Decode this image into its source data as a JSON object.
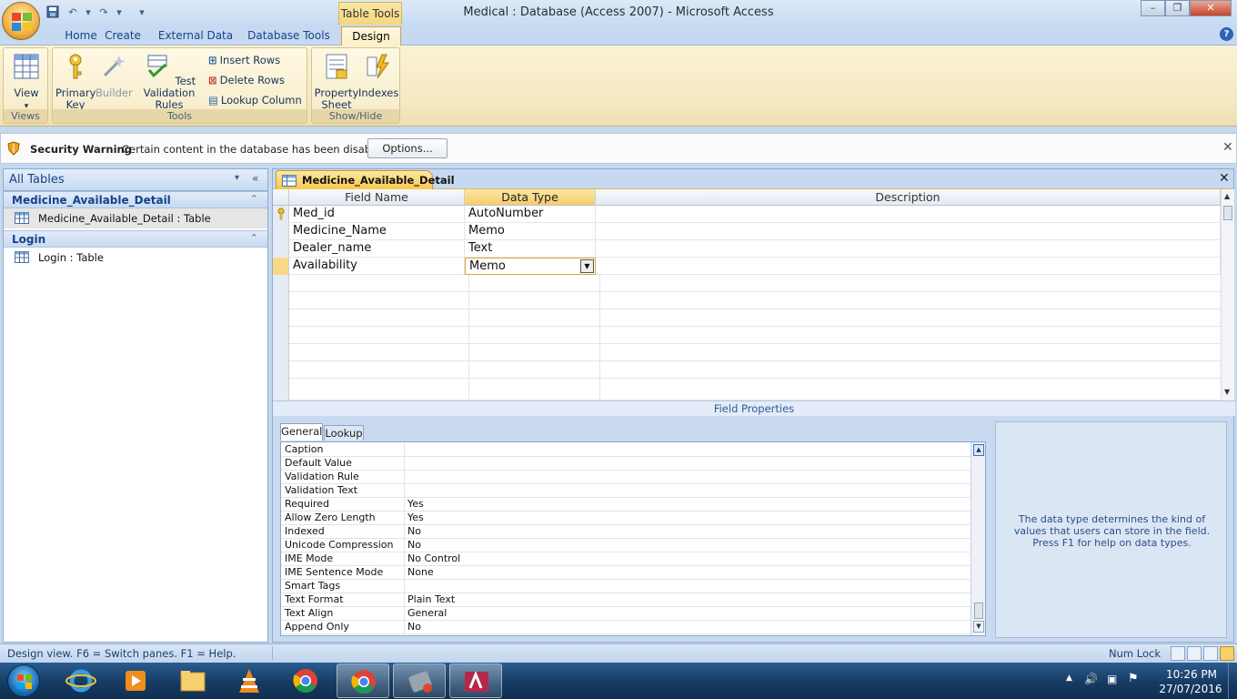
{
  "window": {
    "title": "Medical : Database (Access 2007) - Microsoft Access",
    "contextual_tab": "Table Tools",
    "controls": {
      "minimize": "–",
      "restore": "❐",
      "close": "✕"
    }
  },
  "ribbon": {
    "tabs": [
      {
        "label": "Home"
      },
      {
        "label": "Create"
      },
      {
        "label": "External Data"
      },
      {
        "label": "Database Tools"
      },
      {
        "label": "Design"
      }
    ],
    "active_tab": "Design",
    "groups": {
      "views": {
        "label": "Views",
        "view_button": "View"
      },
      "tools": {
        "label": "Tools",
        "primary_key": [
          "Primary",
          "Key"
        ],
        "builder": "Builder",
        "test_validation": [
          "Test Validation",
          "Rules"
        ],
        "insert_rows": "Insert Rows",
        "delete_rows": "Delete Rows",
        "lookup_column": "Lookup Column"
      },
      "showhide": {
        "label": "Show/Hide",
        "property_sheet": [
          "Property",
          "Sheet"
        ],
        "indexes": "Indexes"
      }
    }
  },
  "security_bar": {
    "title": "Security Warning",
    "message": "Certain content in the database has been disabled",
    "options_button": "Options..."
  },
  "nav_pane": {
    "title": "All Tables",
    "groups": [
      {
        "name": "Medicine_Available_Detail",
        "items": [
          "Medicine_Available_Detail : Table"
        ]
      },
      {
        "name": "Login",
        "items": [
          "Login : Table"
        ]
      }
    ]
  },
  "document": {
    "tab_label": "Medicine_Available_Detail",
    "columns": [
      "Field Name",
      "Data Type",
      "Description"
    ],
    "rows": [
      {
        "field": "Med_id",
        "type": "AutoNumber",
        "description": "",
        "primary_key": true
      },
      {
        "field": "Medicine_Name",
        "type": "Memo",
        "description": ""
      },
      {
        "field": "Dealer_name",
        "type": "Text",
        "description": ""
      },
      {
        "field": "Availability",
        "type": "Memo",
        "description": "",
        "current": true
      }
    ]
  },
  "field_properties": {
    "label": "Field Properties",
    "tabs": [
      "General",
      "Lookup"
    ],
    "properties": [
      {
        "name": "Caption",
        "value": ""
      },
      {
        "name": "Default Value",
        "value": ""
      },
      {
        "name": "Validation Rule",
        "value": ""
      },
      {
        "name": "Validation Text",
        "value": ""
      },
      {
        "name": "Required",
        "value": "Yes"
      },
      {
        "name": "Allow Zero Length",
        "value": "Yes"
      },
      {
        "name": "Indexed",
        "value": "No"
      },
      {
        "name": "Unicode Compression",
        "value": "No"
      },
      {
        "name": "IME Mode",
        "value": "No Control"
      },
      {
        "name": "IME Sentence Mode",
        "value": "None"
      },
      {
        "name": "Smart Tags",
        "value": ""
      },
      {
        "name": "Text Format",
        "value": "Plain Text"
      },
      {
        "name": "Text Align",
        "value": "General"
      },
      {
        "name": "Append Only",
        "value": "No"
      }
    ],
    "help_text": "The data type determines the kind of values that users can store in the field.  Press F1 for help on data types."
  },
  "status_bar": {
    "text": "Design view.  F6 = Switch panes.  F1 = Help.",
    "num_lock": "Num Lock"
  },
  "taskbar": {
    "apps": [
      "ie-icon",
      "media-player-icon",
      "file-explorer-icon",
      "vlc-icon",
      "chrome-icon",
      "chrome-icon",
      "tool-icon",
      "access-icon"
    ],
    "time": "10:26 PM",
    "date": "27/07/2016"
  },
  "colors": {
    "ribbon_bg": "#f5e9c3",
    "accent_orange": "#f7cd6c",
    "nav_text": "#15428b",
    "taskbar": "#173b62"
  }
}
